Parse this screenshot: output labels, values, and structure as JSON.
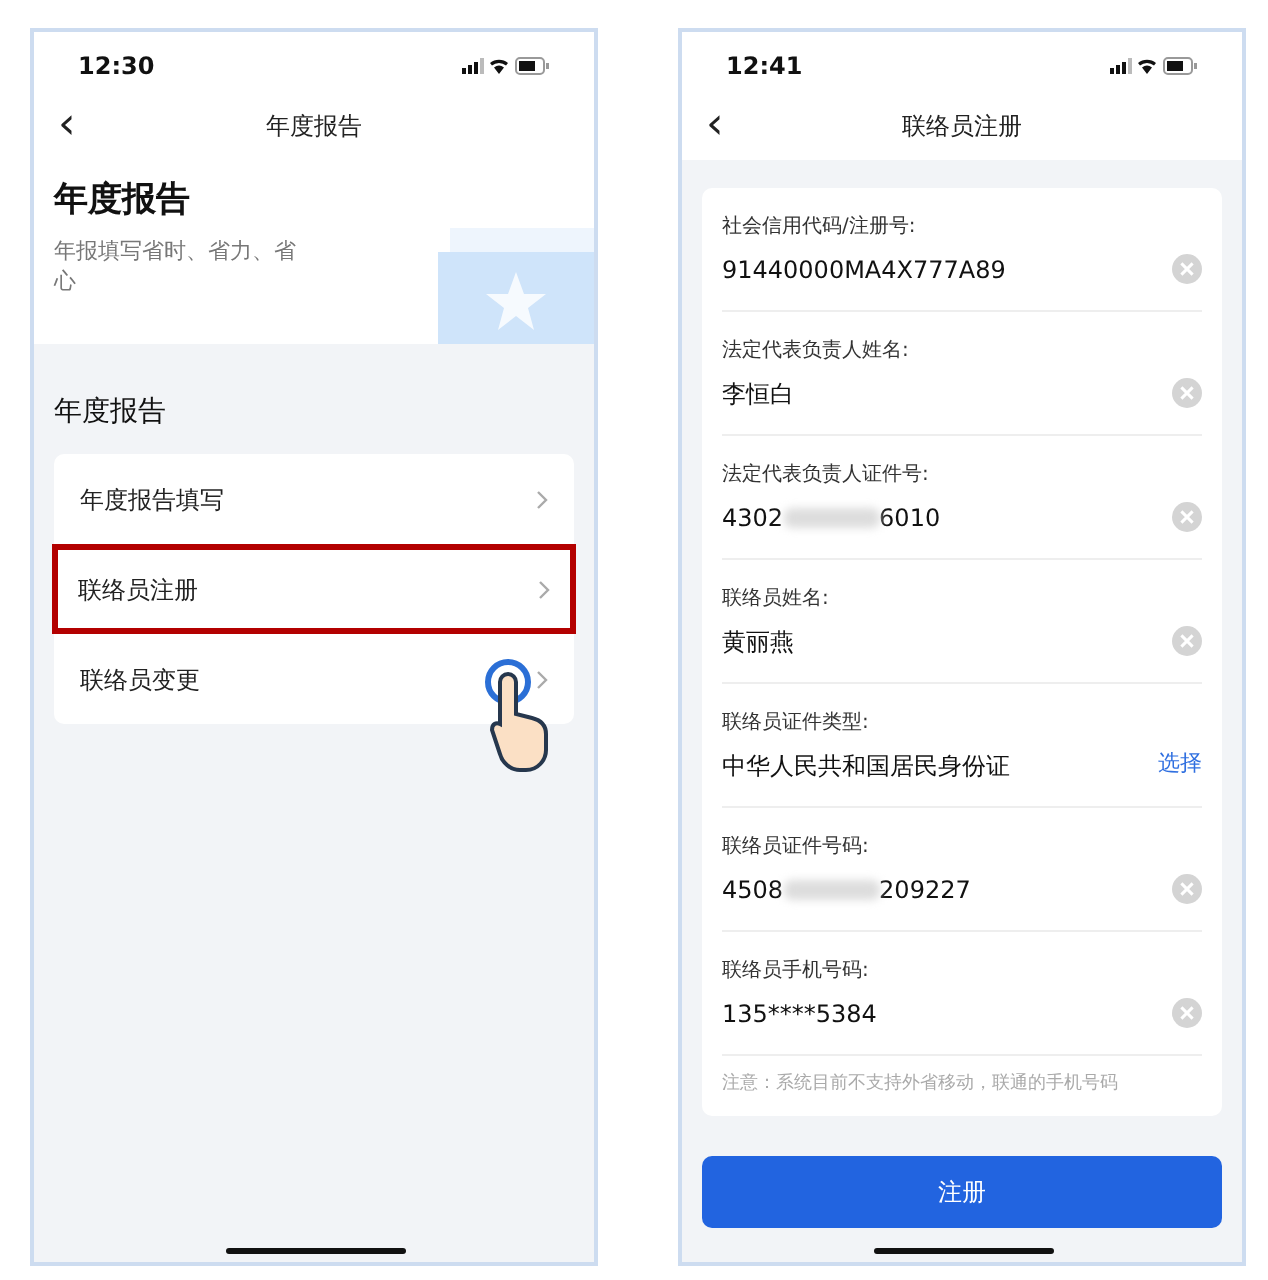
{
  "left_phone": {
    "status_bar": {
      "time": "12:30"
    },
    "nav": {
      "back": "‹",
      "title": "年度报告"
    },
    "header": {
      "title": "年度报告",
      "subtitle": "年报填写省时、省力、省心"
    },
    "section_title": "年度报告",
    "items": [
      {
        "label": "年度报告填写",
        "highlighted": false,
        "tapped": false
      },
      {
        "label": "联络员注册",
        "highlighted": true,
        "tapped": false
      },
      {
        "label": "联络员变更",
        "highlighted": false,
        "tapped": true
      }
    ]
  },
  "right_phone": {
    "status_bar": {
      "time": "12:41"
    },
    "nav": {
      "back": "‹",
      "title": "联络员注册"
    },
    "fields": [
      {
        "kind": "clear",
        "label": "社会信用代码/注册号:",
        "value": "91440000MA4X777A89"
      },
      {
        "kind": "clear",
        "label": "法定代表负责人姓名:",
        "value": "李恒白"
      },
      {
        "kind": "blurred",
        "label": "法定代表负责人证件号:",
        "value_start": "4302",
        "value_end": "6010"
      },
      {
        "kind": "clear",
        "label": "联络员姓名:",
        "value": "黄丽燕"
      },
      {
        "kind": "select",
        "label": "联络员证件类型:",
        "value": "中华人民共和国居民身份证",
        "action": "选择"
      },
      {
        "kind": "blurred",
        "label": "联络员证件号码:",
        "value_start": "4508",
        "value_end": "209227"
      },
      {
        "kind": "clear",
        "label": "联络员手机号码:",
        "value": "135****5384"
      }
    ],
    "note": "注意：系统目前不支持外省移动，联通的手机号码",
    "submit_button": "注册"
  }
}
